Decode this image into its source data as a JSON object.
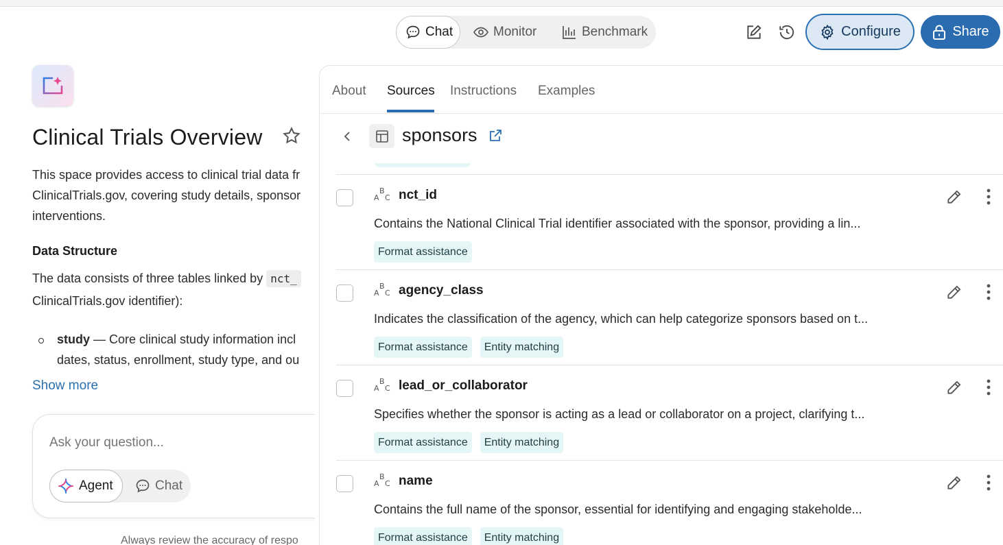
{
  "header": {
    "modes": [
      "Chat",
      "Monitor",
      "Benchmark"
    ],
    "configure_label": "Configure",
    "share_label": "Share"
  },
  "space": {
    "title": "Clinical Trials Overview",
    "desc_lines": [
      "This space provides access to clinical trial data fr",
      "ClinicalTrials.gov, covering study details, sponsor",
      "interventions."
    ],
    "section_heading": "Data Structure",
    "para_line1_pre": "The data consists of three tables linked by",
    "para_code": "nct_",
    "para_line2": "ClinicalTrials.gov identifier):",
    "bullet_term": "study",
    "bullet_line1_rest": " — Core clinical study information incl",
    "bullet_line2": "dates, status, enrollment, study type, and ou",
    "show_more": "Show more"
  },
  "ask": {
    "placeholder": "Ask your question...",
    "agent_label": "Agent",
    "chat_label": "Chat",
    "disclaimer": "Always review the accuracy of respo"
  },
  "panel": {
    "tabs": [
      "About",
      "Sources",
      "Instructions",
      "Examples"
    ],
    "source_name": "sponsors",
    "columns": [
      {
        "name": "nct_id",
        "description": "Contains the National Clinical Trial identifier associated with the sponsor, providing a lin...",
        "tags": [
          "Format assistance"
        ]
      },
      {
        "name": "agency_class",
        "description": "Indicates the classification of the agency, which can help categorize sponsors based on t...",
        "tags": [
          "Format assistance",
          "Entity matching"
        ]
      },
      {
        "name": "lead_or_collaborator",
        "description": "Specifies whether the sponsor is acting as a lead or collaborator on a project, clarifying t...",
        "tags": [
          "Format assistance",
          "Entity matching"
        ]
      },
      {
        "name": "name",
        "description": "Contains the full name of the sponsor, essential for identifying and engaging stakeholde...",
        "tags": [
          "Format assistance",
          "Entity matching"
        ]
      }
    ]
  }
}
